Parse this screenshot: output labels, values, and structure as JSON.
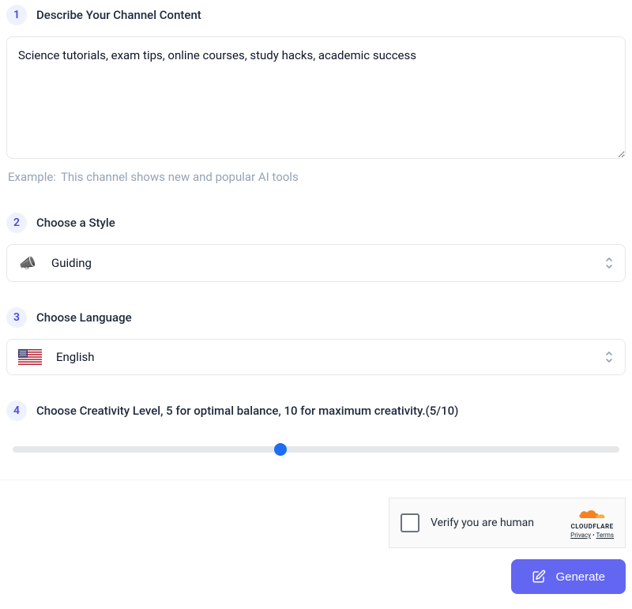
{
  "steps": {
    "describe": {
      "num": "1",
      "title": "Describe Your Channel Content"
    },
    "style": {
      "num": "2",
      "title": "Choose a Style"
    },
    "language": {
      "num": "3",
      "title": "Choose Language"
    },
    "creativity": {
      "num": "4",
      "title": "Choose Creativity Level, 5 for optimal balance, 10 for maximum creativity.(5/10)"
    }
  },
  "content_input": {
    "value": "Science tutorials, exam tips, online courses, study hacks, academic success"
  },
  "example": {
    "prefix": "Example:",
    "text": "This channel shows new and popular AI tools"
  },
  "style_select": {
    "icon": "📣",
    "label": "Guiding"
  },
  "language_select": {
    "label": "English"
  },
  "creativity": {
    "value": 5,
    "min": 0,
    "max": 10,
    "thumb_percent": 44.2
  },
  "captcha": {
    "label": "Verify you are human",
    "brand": "CLOUDFLARE",
    "privacy": "Privacy",
    "terms": "Terms"
  },
  "generate_button": {
    "label": "Generate"
  },
  "colors": {
    "accent": "#6366f1",
    "badge_bg": "#eef2ff",
    "thumb": "#1d6ef0"
  }
}
